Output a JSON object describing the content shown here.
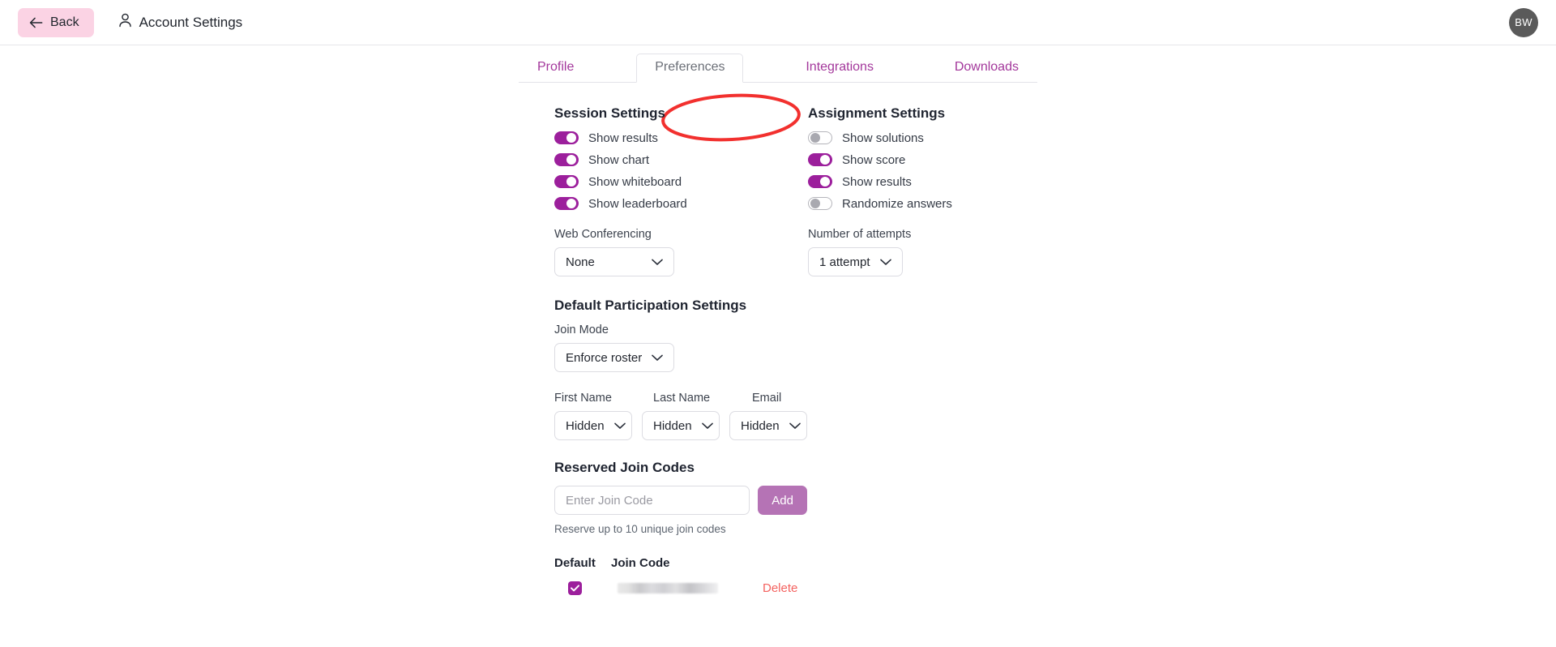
{
  "header": {
    "back_label": "Back",
    "title": "Account Settings",
    "avatar_initials": "BW"
  },
  "tabs": [
    {
      "label": "Profile",
      "active": false
    },
    {
      "label": "Preferences",
      "active": true
    },
    {
      "label": "Integrations",
      "active": false
    },
    {
      "label": "Downloads",
      "active": false
    }
  ],
  "annotation": {
    "shape": "ellipse",
    "color": "#f2302e",
    "target": "Preferences"
  },
  "session_settings": {
    "heading": "Session Settings",
    "toggles": [
      {
        "label": "Show results",
        "on": true
      },
      {
        "label": "Show chart",
        "on": true
      },
      {
        "label": "Show whiteboard",
        "on": true
      },
      {
        "label": "Show leaderboard",
        "on": true
      }
    ],
    "web_conferencing_label": "Web Conferencing",
    "web_conferencing_value": "None"
  },
  "assignment_settings": {
    "heading": "Assignment Settings",
    "toggles": [
      {
        "label": "Show solutions",
        "on": false
      },
      {
        "label": "Show score",
        "on": true
      },
      {
        "label": "Show results",
        "on": true
      },
      {
        "label": "Randomize answers",
        "on": false
      }
    ],
    "attempts_label": "Number of attempts",
    "attempts_value": "1 attempt"
  },
  "participation_settings": {
    "heading": "Default Participation Settings",
    "join_mode_label": "Join Mode",
    "join_mode_value": "Enforce roster",
    "name_columns": [
      {
        "label": "First Name",
        "value": "Hidden"
      },
      {
        "label": "Last Name",
        "value": "Hidden"
      },
      {
        "label": "Email",
        "value": "Hidden"
      }
    ]
  },
  "reserved_join_codes": {
    "heading": "Reserved Join Codes",
    "input_placeholder": "Enter Join Code",
    "input_value": "",
    "add_label": "Add",
    "hint": "Reserve up to 10 unique join codes",
    "table": {
      "columns": [
        "Default",
        "Join Code"
      ],
      "rows": [
        {
          "default_checked": true,
          "join_code": "",
          "redacted": true,
          "delete_label": "Delete"
        }
      ]
    }
  },
  "colors": {
    "accent_purple": "#9c1f9c",
    "tab_link": "#a3379b",
    "back_pink": "#fbd3e4",
    "add_button": "#b573b5",
    "delete_red": "#f4625f",
    "annotation_red": "#f2302e"
  }
}
